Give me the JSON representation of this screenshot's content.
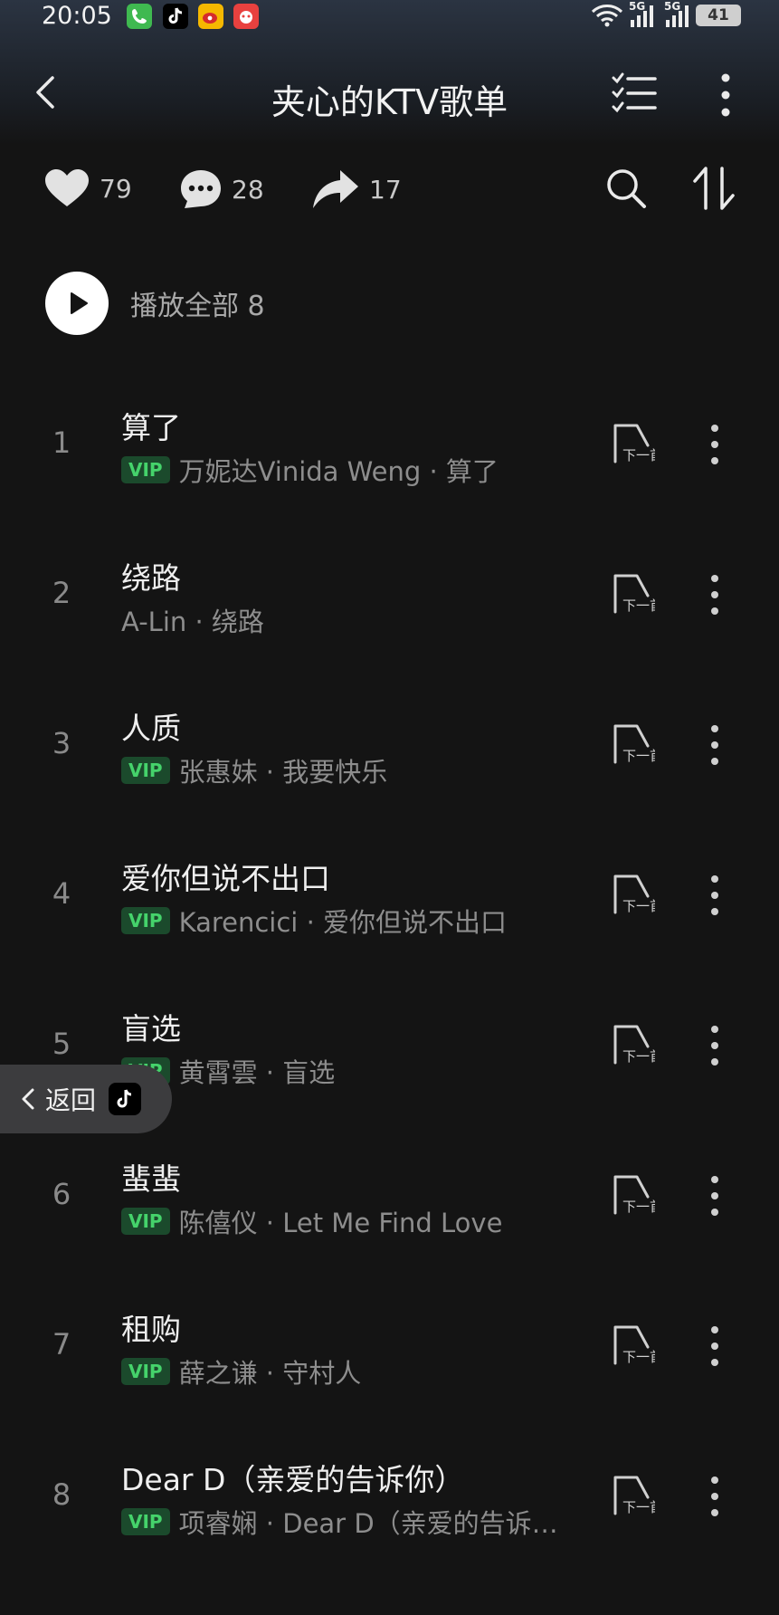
{
  "status_bar": {
    "time": "20:05",
    "network_1": "5G",
    "network_2": "5G",
    "battery": "41",
    "apps": [
      "phone-app",
      "douyin-app",
      "weibo-app",
      "game-app"
    ]
  },
  "header": {
    "title": "夹心的KTV歌单",
    "back_icon": "back-arrow-icon",
    "list_icon": "checklist-icon",
    "more_icon": "more-vertical-icon"
  },
  "actions": {
    "like_count": "79",
    "comment_count": "28",
    "share_count": "17"
  },
  "play_all": {
    "label": "播放全部 8"
  },
  "songs": [
    {
      "index": "1",
      "title": "算了",
      "vip": true,
      "vip_label": "VIP",
      "meta": "万妮达Vinida Weng · 算了"
    },
    {
      "index": "2",
      "title": "绕路",
      "vip": false,
      "vip_label": "",
      "meta": "A-Lin · 绕路"
    },
    {
      "index": "3",
      "title": "人质",
      "vip": true,
      "vip_label": "VIP",
      "meta": "张惠妹 · 我要快乐"
    },
    {
      "index": "4",
      "title": "爱你但说不出口",
      "vip": true,
      "vip_label": "VIP",
      "meta": "Karencici · 爱你但说不出口"
    },
    {
      "index": "5",
      "title": "盲选",
      "vip": true,
      "vip_label": "VIP",
      "meta": "黄霄雲 · 盲选"
    },
    {
      "index": "6",
      "title": "蜚蜚",
      "vip": true,
      "vip_label": "VIP",
      "meta": "陈僖仪 · Let Me Find Love"
    },
    {
      "index": "7",
      "title": "租购",
      "vip": true,
      "vip_label": "VIP",
      "meta": "薛之谦 · 守村人"
    },
    {
      "index": "8",
      "title": "Dear D（亲爱的告诉你）",
      "vip": true,
      "vip_label": "VIP",
      "meta": "项睿娴 · Dear D（亲爱的告诉…"
    }
  ],
  "next_label": "下一首",
  "float_back": {
    "label": "返回"
  },
  "colors": {
    "background": "#141414",
    "vip_green": "#45d36b",
    "vip_bg": "#1b4a2c"
  }
}
